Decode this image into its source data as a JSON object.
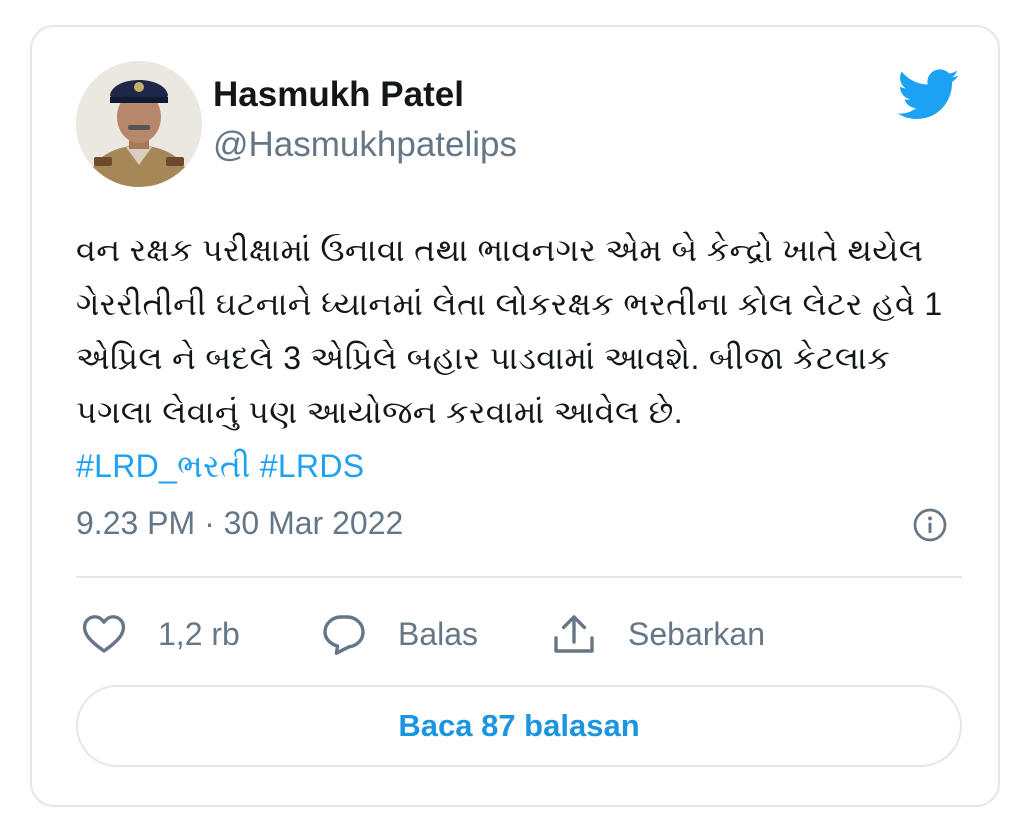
{
  "author": {
    "name": "Hasmukh Patel",
    "handle": "@Hasmukhpatelips"
  },
  "tweet": {
    "lines": [
      "વન રક્ષક પરીક્ષામાં ઉનાવા તથા ભાવનગર એમ બે કેન્દ્રો ખાતે થયેલ",
      "ગેરરીતીની ઘટનાને ધ્યાનમાં લેતા લોકરક્ષક ભરતીના કોલ લેટર હવે 1",
      "એપ્રિલ ને બદલે 3 એપ્રિલે બહાર પાડવામાં આવશે. બીજા કેટલાક",
      "પગલા લેવાનું પણ આયોજન કરવામાં આવેલ છે."
    ],
    "hashtags": [
      "#LRD_ભરતી",
      "#LRDS"
    ],
    "timestamp": "9.23 PM · 30 Mar 2022"
  },
  "actions": {
    "like_count": "1,2 rb",
    "reply_label": "Balas",
    "share_label": "Sebarkan"
  },
  "read_replies_label": "Baca 87 balasan",
  "icons": {
    "brand": "twitter-bird-icon",
    "info": "info-icon",
    "like": "heart-icon",
    "reply": "speech-bubble-icon",
    "share": "share-upload-icon"
  },
  "colors": {
    "twitter_blue": "#1da1f2",
    "link_blue": "#1b95e0",
    "text_primary": "#14171a",
    "text_secondary": "#657786",
    "border": "#e1e8ed"
  }
}
